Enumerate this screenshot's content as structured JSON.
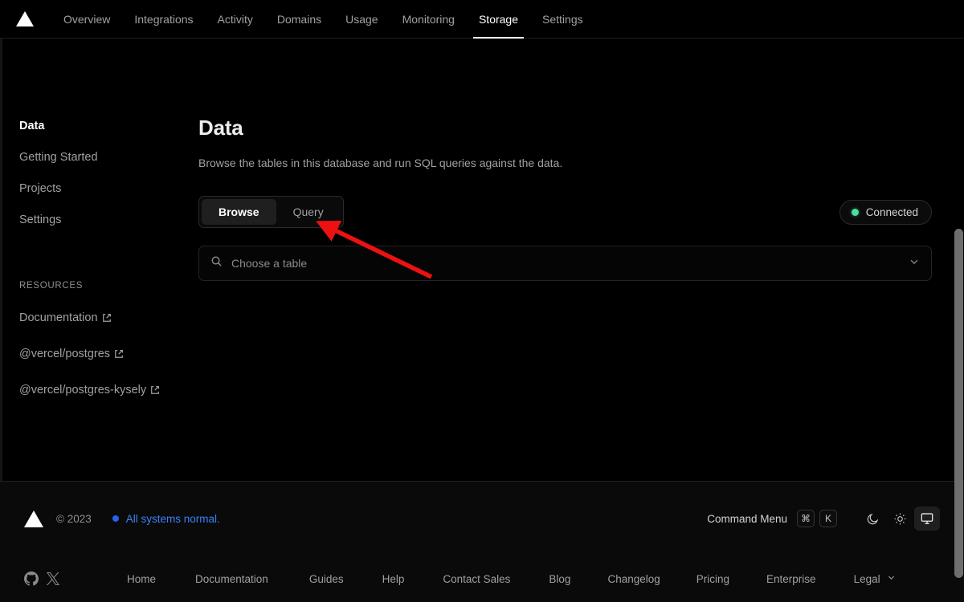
{
  "topnav": {
    "logo_icon": "vercel-triangle-logo",
    "items": [
      {
        "label": "Overview",
        "active": false
      },
      {
        "label": "Integrations",
        "active": false
      },
      {
        "label": "Activity",
        "active": false
      },
      {
        "label": "Domains",
        "active": false
      },
      {
        "label": "Usage",
        "active": false
      },
      {
        "label": "Monitoring",
        "active": false
      },
      {
        "label": "Storage",
        "active": true
      },
      {
        "label": "Settings",
        "active": false
      }
    ]
  },
  "sidebar": {
    "items": [
      {
        "label": "Data",
        "active": true
      },
      {
        "label": "Getting Started",
        "active": false
      },
      {
        "label": "Projects",
        "active": false
      },
      {
        "label": "Settings",
        "active": false
      }
    ],
    "resources_heading": "RESOURCES",
    "resources": [
      {
        "label": "Documentation",
        "icon": "external-link-icon"
      },
      {
        "label": "@vercel/postgres",
        "icon": "external-link-icon"
      },
      {
        "label": "@vercel/postgres-kysely",
        "icon": "external-link-icon"
      }
    ]
  },
  "main": {
    "title": "Data",
    "description": "Browse the tables in this database and run SQL queries against the data.",
    "tabs": [
      {
        "label": "Browse",
        "active": true
      },
      {
        "label": "Query",
        "active": false
      }
    ],
    "status": {
      "label": "Connected",
      "dot_color": "#4ade9f"
    },
    "table_select": {
      "placeholder": "Choose a table",
      "search_icon": "search-icon",
      "chevron_icon": "chevron-down-icon"
    }
  },
  "annotation": {
    "color": "#ee1111",
    "type": "arrow-pointing-to-table-selector"
  },
  "footer": {
    "logo_icon": "vercel-triangle-logo",
    "copyright": "© 2023",
    "status_label": "All systems normal.",
    "status_color": "#3b82f6",
    "command_menu_label": "Command Menu",
    "keys": [
      "⌘",
      "K"
    ],
    "theme_buttons": [
      {
        "icon": "moon-icon",
        "name": "dark-theme",
        "active": false
      },
      {
        "icon": "sun-icon",
        "name": "light-theme",
        "active": false
      },
      {
        "icon": "monitor-icon",
        "name": "system-theme",
        "active": true
      }
    ],
    "socials": [
      {
        "icon": "github-icon"
      },
      {
        "icon": "x-twitter-icon"
      }
    ],
    "links": [
      {
        "label": "Home"
      },
      {
        "label": "Documentation"
      },
      {
        "label": "Guides"
      },
      {
        "label": "Help"
      },
      {
        "label": "Contact Sales"
      },
      {
        "label": "Blog"
      },
      {
        "label": "Changelog"
      },
      {
        "label": "Pricing"
      },
      {
        "label": "Enterprise"
      },
      {
        "label": "Legal",
        "chevron": true
      }
    ]
  }
}
